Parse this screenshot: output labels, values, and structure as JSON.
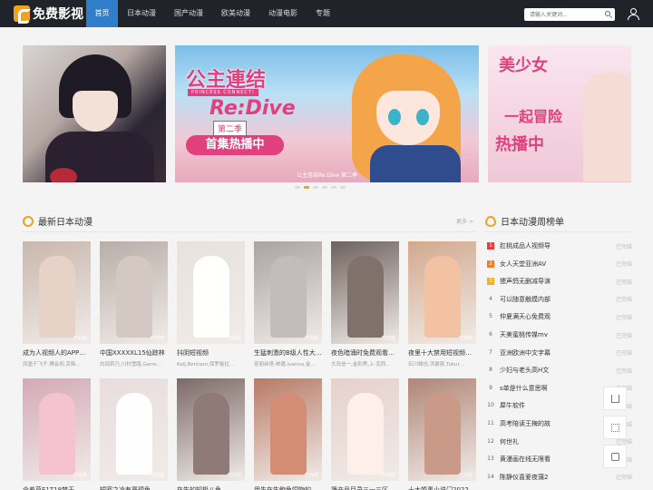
{
  "header": {
    "logo_text": "免费影视",
    "nav": [
      "首页",
      "日本动漫",
      "国产动漫",
      "欧美动漫",
      "动漫电影",
      "专题"
    ],
    "search_placeholder": "请输入关键词..."
  },
  "banner": {
    "center_title1": "公主連结",
    "center_sub": "PRINCESS CONNECT!",
    "center_title2": "Re:Dive",
    "center_season": "第二季",
    "center_hot": "首集热播中",
    "center_caption": "公主连结Re:Dive 第二季",
    "right_text1": "美少女",
    "right_text2": "一起冒险",
    "right_text3": "热播中"
  },
  "latest": {
    "title": "最新日本动漫",
    "more": "更多 >",
    "badge": "已完结",
    "items": [
      {
        "title": "成为人视频人的APP…",
        "actor": "凤凰于飞子,傅会祝,克韩…",
        "color": "#c9b7ad"
      },
      {
        "title": "中国XXXXXL15仙踪林",
        "actor": "白鸽莉乃,川村雪路,Garre…",
        "color": "#b8aea9"
      },
      {
        "title": "抖阴短视频",
        "actor": "Kelj,Bentsen,保罗格拉…",
        "color": "#e8e2dd"
      },
      {
        "title": "生猛刺激的B级人性大…",
        "actor": "奈丽丝塔·林德,Ivanna,金…",
        "color": "#a9a4a3"
      },
      {
        "title": "夜色暗涌时免费观看…",
        "actor": "大岛信一,金彩秀,上·克西…",
        "color": "#6f625d"
      },
      {
        "title": "夜里十大禁用短视频…",
        "actor": "石川雄也,洪爵泉,Tukur…",
        "color": "#d2a98d"
      },
      {
        "title": "含羞草E1T18禁干…",
        "actor": "",
        "color": "#d4a9b6"
      },
      {
        "title": "短密之冷有基德鱼…",
        "actor": "",
        "color": "#e9dddd"
      },
      {
        "title": "在生的知极八鱼…",
        "actor": "",
        "color": "#7c6a68"
      },
      {
        "title": "甲生在生鲍鱼饲物的…",
        "actor": "",
        "color": "#b87b66"
      },
      {
        "title": "簿产品目录三一三区…",
        "actor": "",
        "color": "#e6d0cc"
      },
      {
        "title": "十大婚事小说门2022…",
        "actor": "",
        "color": "#b08676"
      }
    ]
  },
  "ranking": {
    "title": "日本动漫周榜单",
    "status": "已完结",
    "items": [
      {
        "num": "1",
        "name": "肛桃成品人视频导"
      },
      {
        "num": "2",
        "name": "女人天堂亚洲AV"
      },
      {
        "num": "3",
        "name": "猥声鸽无删减导演"
      },
      {
        "num": "4",
        "name": "可以随意触摸内部"
      },
      {
        "num": "5",
        "name": "仲夏满天心免费观"
      },
      {
        "num": "6",
        "name": "天美蜜桃传媒mv"
      },
      {
        "num": "7",
        "name": "亚洲欧洲中文字幕"
      },
      {
        "num": "8",
        "name": "少妇与老头高H文"
      },
      {
        "num": "9",
        "name": "s单是什么意思啊"
      },
      {
        "num": "10",
        "name": "犀牛软件"
      },
      {
        "num": "11",
        "name": "高考陪读王梅的故"
      },
      {
        "num": "12",
        "name": "何世礼"
      },
      {
        "num": "13",
        "name": "黄漫画在线无限看"
      },
      {
        "num": "14",
        "name": "陈静仪喜爱夜蒲2"
      }
    ]
  }
}
